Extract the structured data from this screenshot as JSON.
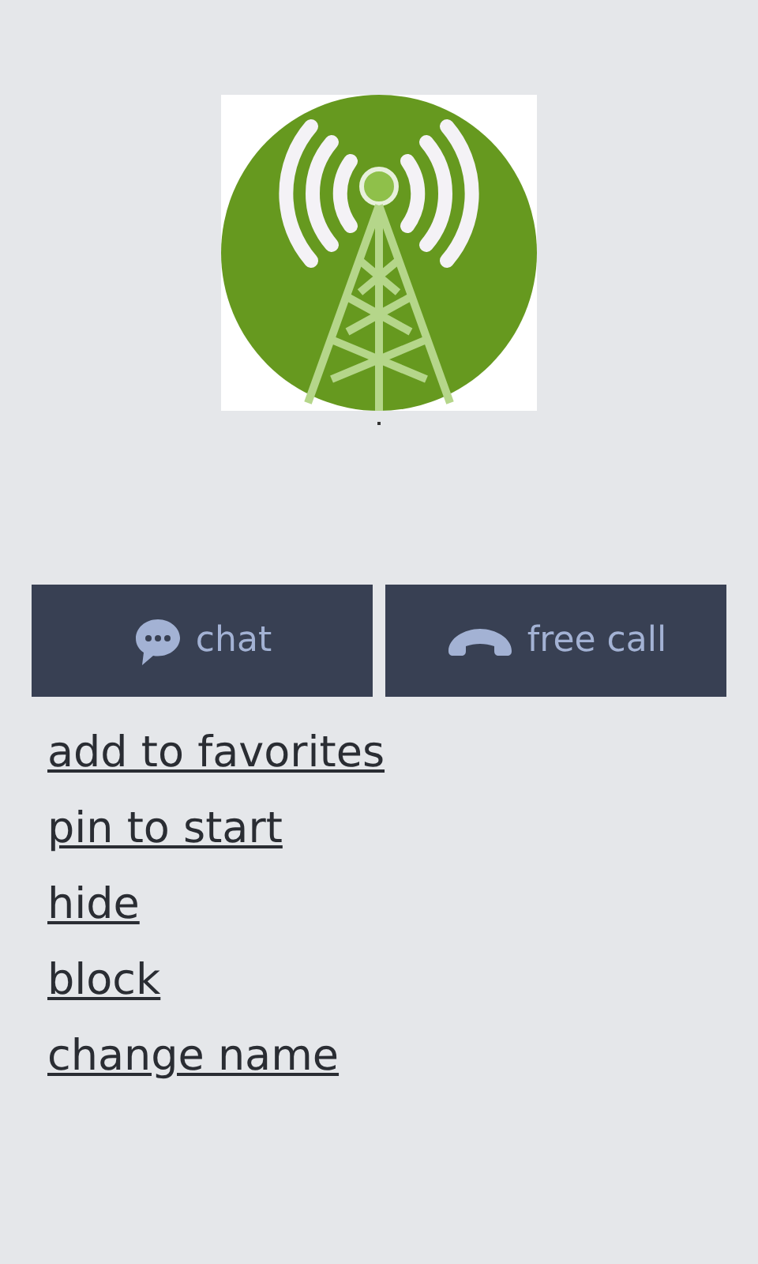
{
  "actions": [
    {
      "kind": "chat",
      "label": "chat"
    },
    {
      "kind": "call",
      "label": "free call"
    }
  ],
  "menu": [
    "add to favorites",
    "pin to start",
    "hide",
    "block",
    "change name"
  ]
}
